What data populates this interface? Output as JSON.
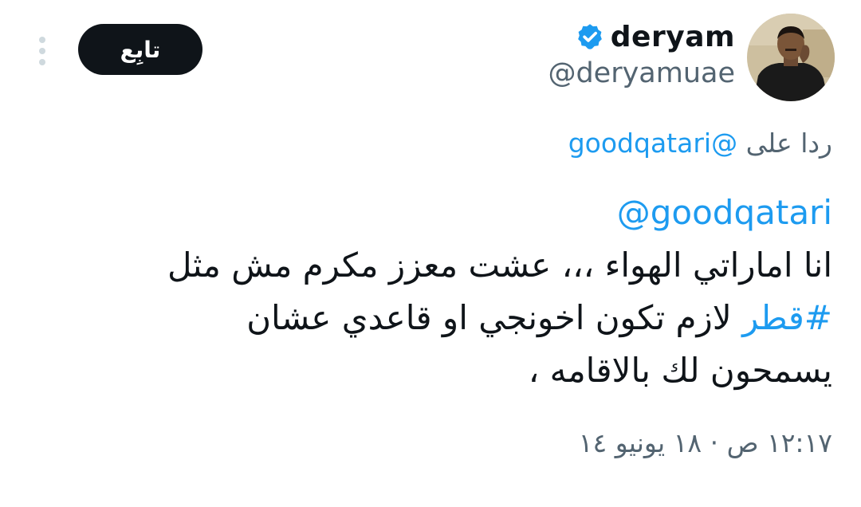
{
  "author": {
    "display_name": "deryam",
    "handle": "@deryamuae",
    "verified": true,
    "avatar_icon": "profile-photo"
  },
  "actions": {
    "follow_label": "تابِع",
    "more_icon": "more-vertical-icon"
  },
  "reply": {
    "prefix": "ردا على",
    "mention": "@goodqatari"
  },
  "body": {
    "mention": "@goodqatari",
    "line1": "انا اماراتي الهواء ،،، عشت معزز مكرم مش مثل",
    "hashtag": "#قطر",
    "line2_rest": " لازم تكون اخونجي او قاعدي عشان",
    "line3": "يسمحون لك بالاقامه ،"
  },
  "timestamp": "١٢:١٧ ص · ١٨ يونيو ١٤",
  "colors": {
    "text": "#0f1419",
    "secondary": "#536471",
    "link": "#1d9bf0",
    "follow_bg": "#0f1419",
    "follow_text": "#ffffff"
  }
}
